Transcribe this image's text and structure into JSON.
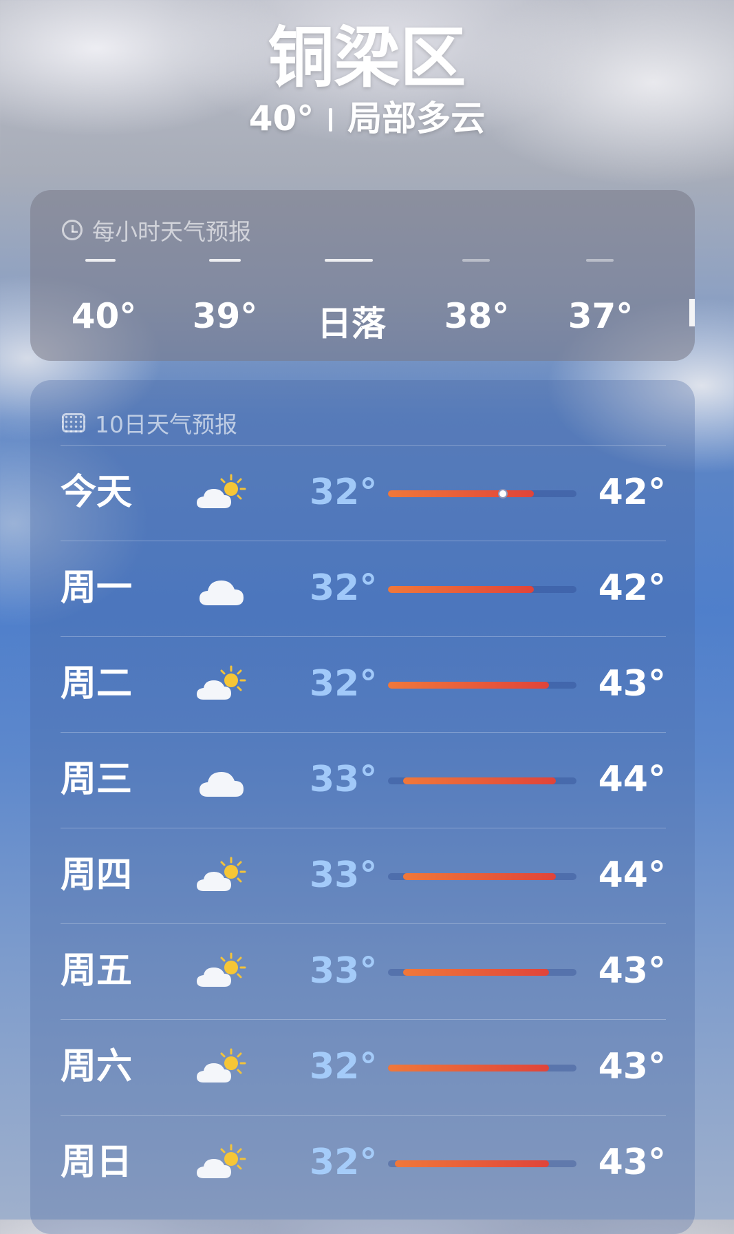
{
  "header": {
    "city": "铜梁区",
    "temp": "40°",
    "condition": "局部多云"
  },
  "hourly": {
    "title": "每小时天气预报",
    "items": [
      {
        "label": "40°"
      },
      {
        "label": "39°"
      },
      {
        "label": "日落"
      },
      {
        "label": "38°"
      },
      {
        "label": "37°"
      }
    ]
  },
  "daily": {
    "title": "10日天气预报",
    "days": [
      {
        "name": "今天",
        "icon": "partly-cloudy-icon",
        "low": "32°",
        "high": "42°",
        "current": "40°"
      },
      {
        "name": "周一",
        "icon": "cloud-icon",
        "low": "32°",
        "high": "42°"
      },
      {
        "name": "周二",
        "icon": "partly-cloudy-icon",
        "low": "32°",
        "high": "43°"
      },
      {
        "name": "周三",
        "icon": "cloud-icon",
        "low": "33°",
        "high": "44°"
      },
      {
        "name": "周四",
        "icon": "partly-cloudy-icon",
        "low": "33°",
        "high": "44°"
      },
      {
        "name": "周五",
        "icon": "partly-cloudy-icon",
        "low": "33°",
        "high": "43°"
      },
      {
        "name": "周六",
        "icon": "partly-cloudy-icon",
        "low": "32°",
        "high": "43°"
      },
      {
        "name": "周日",
        "icon": "partly-cloudy-icon",
        "low": "32°",
        "high": "43°"
      }
    ]
  },
  "colors": {
    "bar_start": "#f0783a",
    "bar_end": "#e0443a",
    "low_temp": "#aad2ff"
  }
}
